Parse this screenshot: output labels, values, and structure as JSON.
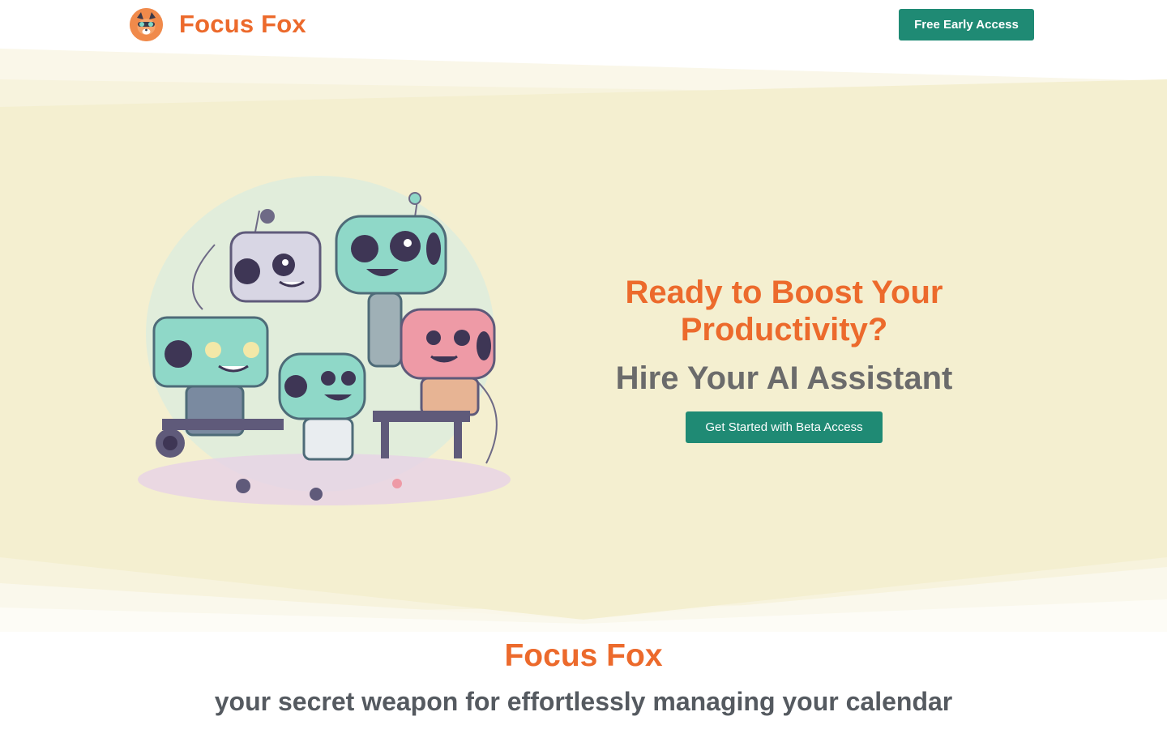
{
  "header": {
    "brand": "Focus Fox",
    "cta_label": "Free Early Access"
  },
  "hero": {
    "title": "Ready to Boost Your Productivity?",
    "subtitle": "Hire Your AI Assistant",
    "cta_label": "Get Started with Beta Access",
    "illustration": "robots-illustration"
  },
  "section": {
    "title": "Focus Fox",
    "subtitle": "your secret weapon for effortlessly managing your calendar"
  },
  "colors": {
    "accent": "#ec6a2c",
    "button": "#1f8a74",
    "hero_bg": "#f4efd0",
    "text_gray": "#6b6b6b"
  }
}
